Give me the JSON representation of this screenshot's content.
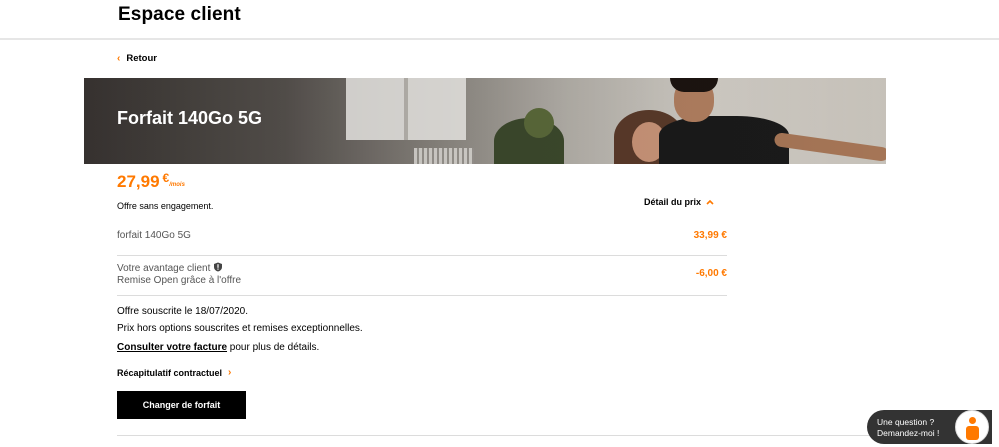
{
  "header": {
    "title": "Espace client"
  },
  "nav": {
    "back_label": "Retour"
  },
  "banner": {
    "title": "Forfait 140Go 5G"
  },
  "price": {
    "amount": "27,99",
    "currency": "€",
    "period": "/mois"
  },
  "offer": {
    "commitment": "Offre sans engagement.",
    "price_detail_label": "Détail du prix"
  },
  "details": [
    {
      "label": "forfait 140Go 5G",
      "value": "33,99 €"
    },
    {
      "label": "Votre avantage client",
      "sublabel": "Remise Open grâce à l'offre",
      "value": "-6,00 €"
    }
  ],
  "notes": {
    "subscribed": "Offre souscrite le 18/07/2020.",
    "exclusions": "Prix hors options souscrites et remises exceptionnelles.",
    "invoice_link": "Consulter votre facture",
    "invoice_suffix": " pour plus de détails."
  },
  "recap": {
    "label": "Récapitulatif contractuel"
  },
  "actions": {
    "change_plan": "Changer de forfait"
  },
  "chat": {
    "line1": "Une question ?",
    "line2": "Demandez-moi !"
  },
  "colors": {
    "accent": "#ff7900",
    "text": "#000000",
    "button_bg": "#000000"
  },
  "icons": {
    "back": "chevron-left-icon",
    "detail": "chevron-up-icon",
    "recap": "chevron-right-icon",
    "info": "info-shield-icon"
  }
}
